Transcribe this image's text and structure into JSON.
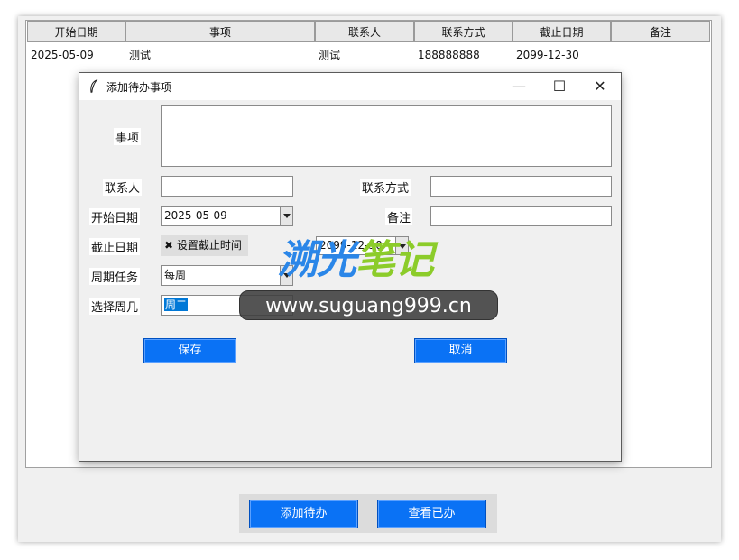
{
  "table": {
    "headers": [
      "开始日期",
      "事项",
      "联系人",
      "联系方式",
      "截止日期",
      "备注"
    ],
    "rows": [
      [
        "2025-05-09",
        "测试",
        "测试",
        "188888888",
        "2099-12-30",
        ""
      ]
    ]
  },
  "bottom_buttons": {
    "add_label": "添加待办",
    "view_label": "查看已办"
  },
  "dialog": {
    "title": "添加待办事项",
    "minimize_glyph": "—",
    "maximize_glyph": "☐",
    "close_glyph": "✕",
    "fields": {
      "item_label": "事项",
      "contact_label": "联系人",
      "contact_method_label": "联系方式",
      "start_date_label": "开始日期",
      "start_date_value": "2025-05-09",
      "note_label": "备注",
      "deadline_label": "截止日期",
      "deadline_checkbox_mark": "✖",
      "deadline_checkbox_label": "设置截止时间",
      "deadline_value": "2099-12-30",
      "period_label": "周期任务",
      "period_value": "每周",
      "weekday_label": "选择周几",
      "weekday_value": "周二"
    },
    "save_label": "保存",
    "cancel_label": "取消"
  },
  "watermark": {
    "brand_part1": "溯光",
    "brand_part2": "笔记",
    "url": "www.suguang999.cn"
  },
  "colors": {
    "accent_blue": "#0a72f5",
    "watermark_blue": "#2a86e8",
    "watermark_green": "#8ccc2a"
  }
}
